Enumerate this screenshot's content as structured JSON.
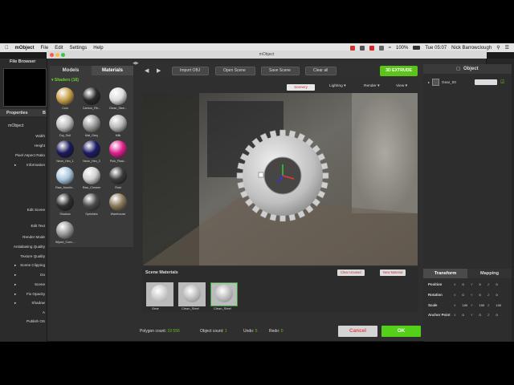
{
  "menubar": {
    "app": "mObject",
    "items": [
      "File",
      "Edit",
      "Settings",
      "Help"
    ],
    "battery": "100%",
    "clock": "Tue 05:07",
    "user": "Nick Barrowclough"
  },
  "dialog_title": "mObject",
  "left": {
    "file_browser": "File Browser",
    "properties": "Properties",
    "tab2": "B",
    "mobject": "mObject",
    "rows": [
      "Width",
      "Height",
      "Pixel Aspect Ratio",
      "Information",
      "Edit Scene",
      "Edit Text",
      "Render Mode",
      "Antialiasing Quality",
      "Texture Quality",
      "Scene Clipping",
      "Do",
      "Scene",
      "Fix Opacity",
      "Shadow",
      "A",
      "Publish OS"
    ]
  },
  "library": {
    "tab_models": "Models",
    "tab_materials": "Materials",
    "shaders_header": "Shaders (16)",
    "shaders": [
      {
        "name": "Coin",
        "color": "#c8a24a"
      },
      {
        "name": "Carbon_Fib...",
        "color": "#2a2a2a"
      },
      {
        "name": "Clean_Stee...",
        "color": "#dcdcdc"
      },
      {
        "name": "Dry_Soil",
        "color": "#bdbdbd"
      },
      {
        "name": "Mat_Grey",
        "color": "#9a9a9a"
      },
      {
        "name": "Milk",
        "color": "#b8b8b8"
      },
      {
        "name": "Neon_Hex_1",
        "color": "#1a1a5a"
      },
      {
        "name": "Neon_Hex_2",
        "color": "#1b1b66"
      },
      {
        "name": "Pink_Plast...",
        "color": "#e0208f"
      },
      {
        "name": "Raw_Alumin...",
        "color": "#aac6dd"
      },
      {
        "name": "Raw_Chrome",
        "color": "#cfcfcf"
      },
      {
        "name": "Rust",
        "color": "#3a3a3a"
      },
      {
        "name": "Shadow",
        "color": "#2f2f2f"
      },
      {
        "name": "Sprinkles",
        "color": "#4a4a4a"
      },
      {
        "name": "Warehouse",
        "color": "#8a7a5a"
      },
      {
        "name": "Wiped_Conc...",
        "color": "#9a9a9a"
      }
    ]
  },
  "toolbar": {
    "import": "Import OBJ",
    "open": "Open Scene",
    "save": "Save Scene",
    "clear": "Clear all",
    "extrude": "3D EXTRUDE"
  },
  "viewport_bar": {
    "scenery": "Scenery",
    "lighting": "Lighting",
    "render": "Render",
    "view": "View"
  },
  "scene_materials": {
    "title": "Scene Materials",
    "clear_unused": "Clear Unused",
    "new_material": "New Material",
    "items": [
      "Gear",
      "Clean_Steel",
      "Clean_Steel"
    ]
  },
  "status": {
    "polygon_label": "Polygon count:",
    "polygon_value": "19 556",
    "object_label": "Object count:",
    "object_value": "1",
    "undo_label": "Undo:",
    "undo_value": "5",
    "redo_label": "Redo:",
    "redo_value": "0"
  },
  "buttons": {
    "cancel": "Cancel",
    "ok": "OK"
  },
  "object_panel": {
    "title": "Object",
    "item_name": "Gear_00",
    "tab_transform": "Transform",
    "tab_mapping": "Mapping",
    "rows": [
      {
        "label": "Position",
        "vals": [
          "X",
          "0",
          "Y",
          "0",
          "Z",
          "0"
        ]
      },
      {
        "label": "Rotation",
        "vals": [
          "X",
          "0",
          "Y",
          "0",
          "Z",
          "0"
        ]
      },
      {
        "label": "Scale",
        "vals": [
          "X",
          "100",
          "Y",
          "100",
          "Z",
          "100"
        ]
      },
      {
        "label": "Anchor Point",
        "vals": [
          "X",
          "0",
          "Y",
          "0",
          "Z",
          "0"
        ]
      }
    ]
  },
  "colors": {
    "accent_green": "#5ec21c",
    "ok_green": "#55d01a",
    "selection": "#35a435"
  }
}
